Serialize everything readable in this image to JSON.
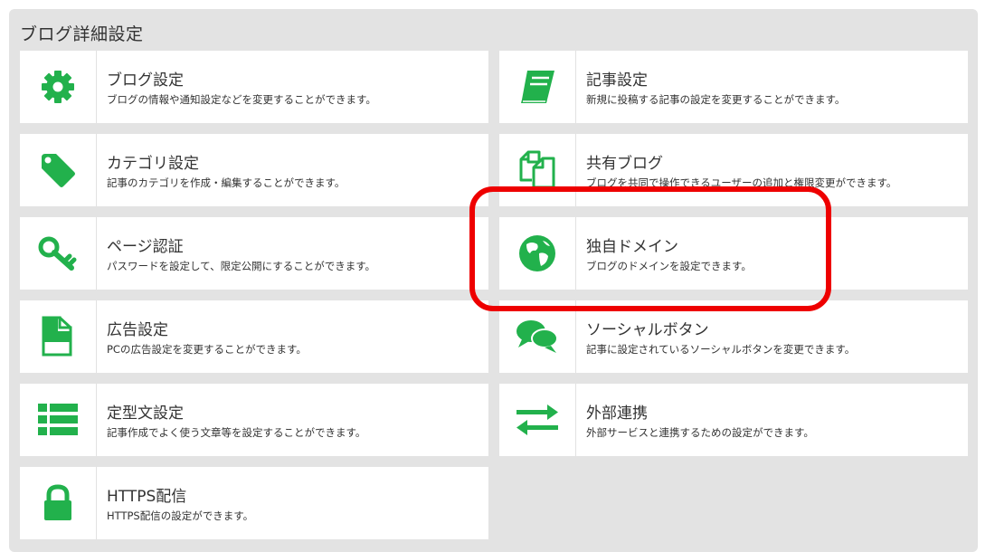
{
  "panel": {
    "title": "ブログ詳細設定"
  },
  "colors": {
    "accent": "#22b14c",
    "highlight": "#ee0000"
  },
  "items": [
    {
      "title": "ブログ設定",
      "desc": "ブログの情報や通知設定などを変更することができます。",
      "icon": "gear-icon"
    },
    {
      "title": "記事設定",
      "desc": "新規に投稿する記事の設定を変更することができます。",
      "icon": "book-icon"
    },
    {
      "title": "カテゴリ設定",
      "desc": "記事のカテゴリを作成・編集することができます。",
      "icon": "tag-icon"
    },
    {
      "title": "共有ブログ",
      "desc": "ブログを共同で操作できるユーザーの追加と権限変更ができます。",
      "icon": "copy-documents-icon"
    },
    {
      "title": "ページ認証",
      "desc": "パスワードを設定して、限定公開にすることができます。",
      "icon": "key-icon"
    },
    {
      "title": "独自ドメイン",
      "desc": "ブログのドメインを設定できます。",
      "icon": "globe-icon"
    },
    {
      "title": "広告設定",
      "desc": "PCの広告設定を変更することができます。",
      "icon": "file-icon"
    },
    {
      "title": "ソーシャルボタン",
      "desc": "記事に設定されているソーシャルボタンを変更できます。",
      "icon": "chat-bubbles-icon"
    },
    {
      "title": "定型文設定",
      "desc": "記事作成でよく使う文章等を設定することができます。",
      "icon": "list-icon"
    },
    {
      "title": "外部連携",
      "desc": "外部サービスと連携するための設定ができます。",
      "icon": "exchange-arrows-icon"
    },
    {
      "title": "HTTPS配信",
      "desc": "HTTPS配信の設定ができます。",
      "icon": "lock-icon"
    }
  ]
}
